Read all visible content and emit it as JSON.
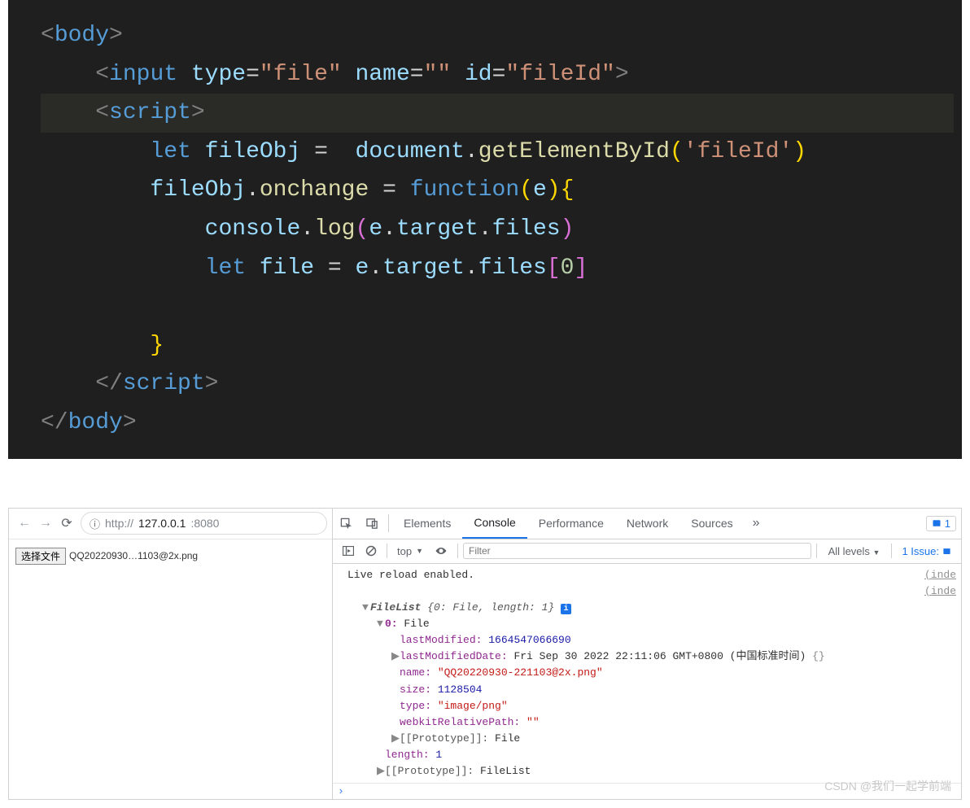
{
  "code": {
    "lines": [
      {
        "indent": 0,
        "html": "<span class='angle'>&lt;</span><span class='tag'>body</span><span class='angle'>&gt;</span>"
      },
      {
        "indent": 1,
        "html": "<span class='angle'>&lt;</span><span class='tag'>input</span> <span class='attr'>type</span><span class='punct'>=</span><span class='str'>\"file\"</span> <span class='attr'>name</span><span class='punct'>=</span><span class='str'>\"\"</span> <span class='attr'>id</span><span class='punct'>=</span><span class='str'>\"fileId\"</span><span class='angle'>&gt;</span>"
      },
      {
        "indent": 1,
        "hl": true,
        "html": "<span class='angle'>&lt;</span><span class='tag'>script</span><span class='angle'>&gt;</span>"
      },
      {
        "indent": 2,
        "html": "<span class='keyw'>let</span> <span class='var'>fileObj</span> <span class='punct'>=</span>  <span class='var'>document</span><span class='punct'>.</span><span class='func'>getElementById</span><span class='paren1'>(</span><span class='str'>'fileId'</span><span class='paren1'>)</span>"
      },
      {
        "indent": 2,
        "html": "<span class='var'>fileObj</span><span class='punct'>.</span><span class='func'>onchange</span> <span class='punct'>=</span> <span class='keyw'>function</span><span class='paren1'>(</span><span class='var'>e</span><span class='paren1'>)</span><span class='brace'>{</span>"
      },
      {
        "indent": 3,
        "html": "<span class='var'>console</span><span class='punct'>.</span><span class='func'>log</span><span class='paren2'>(</span><span class='var'>e</span><span class='punct'>.</span><span class='var'>target</span><span class='punct'>.</span><span class='var'>files</span><span class='paren2'>)</span>"
      },
      {
        "indent": 3,
        "html": "<span class='keyw'>let</span> <span class='var'>file</span> <span class='punct'>=</span> <span class='var'>e</span><span class='punct'>.</span><span class='var'>target</span><span class='punct'>.</span><span class='var'>files</span><span class='brack'>[</span><span class='num'>0</span><span class='brack'>]</span>"
      },
      {
        "indent": 3,
        "html": " "
      },
      {
        "indent": 2,
        "html": "<span class='brace'>}</span>"
      },
      {
        "indent": 1,
        "html": "<span class='angle'>&lt;/</span><span class='tag'>script</span><span class='angle'>&gt;</span>"
      },
      {
        "indent": 0,
        "html": "<span class='angle'>&lt;/</span><span class='tag'>body</span><span class='angle'>&gt;</span>"
      }
    ]
  },
  "browser": {
    "url_host": "127.0.0.1",
    "url_port": ":8080",
    "file_button": "选择文件",
    "file_name": "QQ20220930…1103@2x.png"
  },
  "devtools": {
    "tabs": [
      "Elements",
      "Console",
      "Performance",
      "Network",
      "Sources"
    ],
    "active_tab": "Console",
    "more": "»",
    "issues_count": "1",
    "toolbar": {
      "context": "top",
      "filter_placeholder": "Filter",
      "levels": "All levels",
      "issue": "1 Issue:"
    },
    "logs": {
      "live_reload": "Live reload enabled.",
      "source_link": "(inde",
      "filelist_summary_1": "FileList ",
      "filelist_summary_2": "{0: File, length: 1}",
      "file_index": "0:",
      "file_type": "File",
      "lastModified_key": "lastModified:",
      "lastModified_val": "1664547066690",
      "lastModifiedDate_key": "lastModifiedDate:",
      "lastModifiedDate_val": "Fri Sep 30 2022 22:11:06 GMT+0800 (中国标准时间)",
      "name_key": "name:",
      "name_val": "\"QQ20220930-221103@2x.png\"",
      "size_key": "size:",
      "size_val": "1128504",
      "type_key": "type:",
      "type_val": "\"image/png\"",
      "webkit_key": "webkitRelativePath:",
      "webkit_val": "\"\"",
      "proto_key": "[[Prototype]]:",
      "proto_val_file": "File",
      "length_key": "length:",
      "length_val": "1",
      "proto_val_filelist": "FileList",
      "empty_obj": "{}",
      "info_badge": "i"
    }
  },
  "watermark": "CSDN @我们一起学前端"
}
